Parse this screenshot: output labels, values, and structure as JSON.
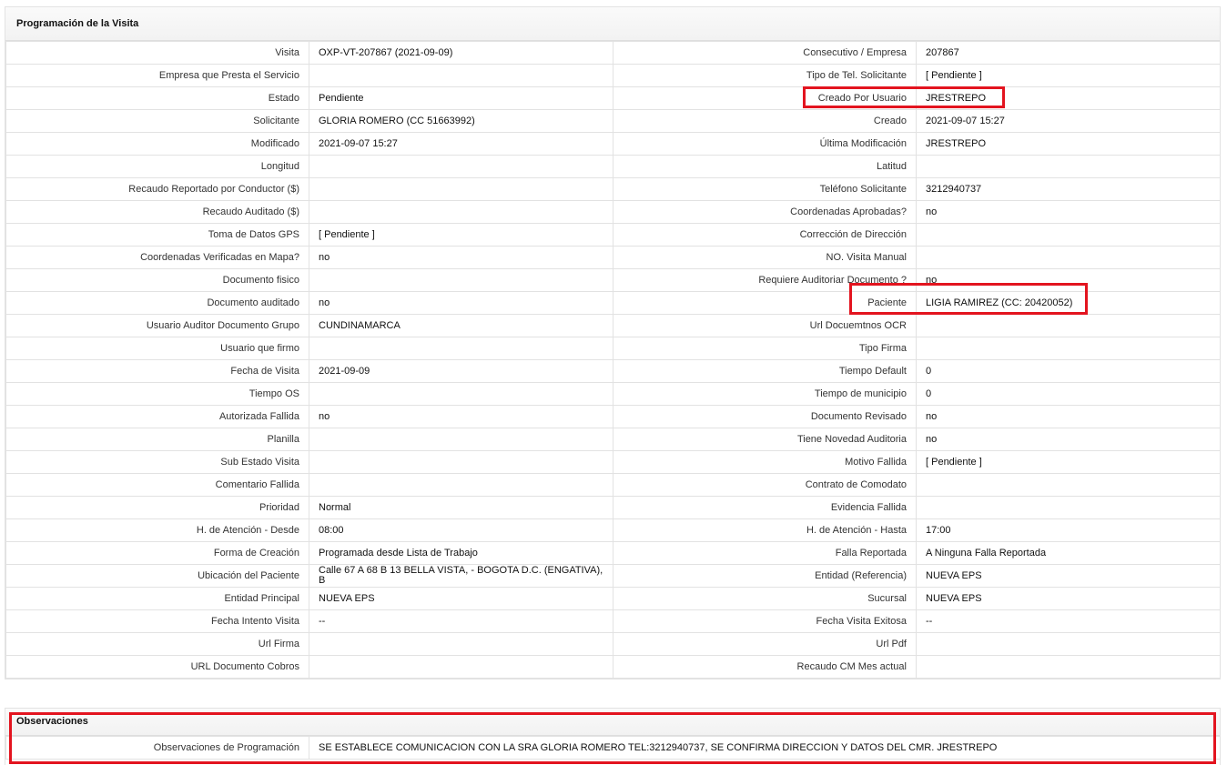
{
  "section_title": "Programación de la Visita",
  "rows": [
    {
      "l1": "Visita",
      "v1": "OXP-VT-207867 (2021-09-09)",
      "l2": "Consecutivo / Empresa",
      "v2": "207867"
    },
    {
      "l1": "Empresa que Presta el Servicio",
      "v1": "",
      "l2": "Tipo de Tel. Solicitante",
      "v2": "[ Pendiente ]"
    },
    {
      "l1": "Estado",
      "v1": "Pendiente",
      "l2": "Creado Por Usuario",
      "v2": "JRESTREPO"
    },
    {
      "l1": "Solicitante",
      "v1": "GLORIA ROMERO (CC 51663992)",
      "l2": "Creado",
      "v2": "2021-09-07 15:27"
    },
    {
      "l1": "Modificado",
      "v1": "2021-09-07 15:27",
      "l2": "Última Modificación",
      "v2": " JRESTREPO"
    },
    {
      "l1": "Longitud",
      "v1": "",
      "l2": "Latitud",
      "v2": ""
    },
    {
      "l1": "Recaudo Reportado por Conductor ($)",
      "v1": "",
      "l2": "Teléfono Solicitante",
      "v2": "3212940737"
    },
    {
      "l1": "Recaudo Auditado ($)",
      "v1": "",
      "l2": "Coordenadas Aprobadas?",
      "v2": " no"
    },
    {
      "l1": "Toma de Datos GPS",
      "v1": "[ Pendiente ]",
      "l2": "Corrección de Dirección",
      "v2": ""
    },
    {
      "l1": "Coordenadas Verificadas en Mapa?",
      "v1": " no",
      "l2": "NO. Visita Manual",
      "v2": ""
    },
    {
      "l1": "Documento fisico",
      "v1": "",
      "l2": "Requiere Auditoriar Documento ?",
      "v2": " no"
    },
    {
      "l1": "Documento auditado",
      "v1": " no",
      "l2": "Paciente",
      "v2": "LIGIA RAMIREZ (CC: 20420052)"
    },
    {
      "l1": "Usuario Auditor Documento Grupo",
      "v1": "CUNDINAMARCA",
      "l2": "Url Docuemtnos OCR",
      "v2": ""
    },
    {
      "l1": "Usuario que firmo",
      "v1": "",
      "l2": "Tipo Firma",
      "v2": ""
    },
    {
      "l1": "Fecha de Visita",
      "v1": " 2021-09-09",
      "l2": "Tiempo Default",
      "v2": "0"
    },
    {
      "l1": "Tiempo OS",
      "v1": "",
      "l2": "Tiempo de municipio",
      "v2": "0"
    },
    {
      "l1": "Autorizada Fallida",
      "v1": " no",
      "l2": "Documento Revisado",
      "v2": " no"
    },
    {
      "l1": "Planilla",
      "v1": "",
      "l2": "Tiene Novedad Auditoria",
      "v2": " no"
    },
    {
      "l1": "Sub Estado Visita",
      "v1": "",
      "l2": "Motivo Fallida",
      "v2": "[ Pendiente ]"
    },
    {
      "l1": "Comentario Fallida",
      "v1": "",
      "l2": "Contrato de Comodato",
      "v2": ""
    },
    {
      "l1": "Prioridad",
      "v1": "Normal",
      "l2": "Evidencia Fallida",
      "v2": ""
    },
    {
      "l1": "H. de Atención - Desde",
      "v1": "08:00",
      "l2": "H. de Atención - Hasta",
      "v2": "17:00"
    },
    {
      "l1": "Forma de Creación",
      "v1": "Programada desde Lista de Trabajo",
      "l2": "Falla Reportada",
      "v2": "A Ninguna Falla Reportada"
    },
    {
      "l1": "Ubicación del Paciente",
      "v1": "Calle 67 A 68 B 13 BELLA VISTA, - BOGOTA D.C. (ENGATIVA), B",
      "l2": "Entidad (Referencia)",
      "v2": "NUEVA EPS"
    },
    {
      "l1": "Entidad Principal",
      "v1": "NUEVA EPS",
      "l2": "Sucursal",
      "v2": "NUEVA EPS"
    },
    {
      "l1": "Fecha Intento Visita",
      "v1": " --",
      "l2": "Fecha Visita Exitosa",
      "v2": " --"
    },
    {
      "l1": "Url Firma",
      "v1": "",
      "l2": "Url Pdf",
      "v2": ""
    },
    {
      "l1": "URL Documento Cobros",
      "v1": "",
      "l2": "Recaudo CM Mes actual",
      "v2": ""
    }
  ],
  "observaciones": {
    "title": "Observaciones",
    "label": "Observaciones de Programación",
    "value": " SE ESTABLECE COMUNICACION CON LA SRA GLORIA ROMERO TEL:3212940737, SE CONFIRMA DIRECCION Y DATOS DEL CMR. JRESTREPO"
  },
  "colors": {
    "highlight": "#e3141f",
    "border": "#e2e2e2"
  }
}
